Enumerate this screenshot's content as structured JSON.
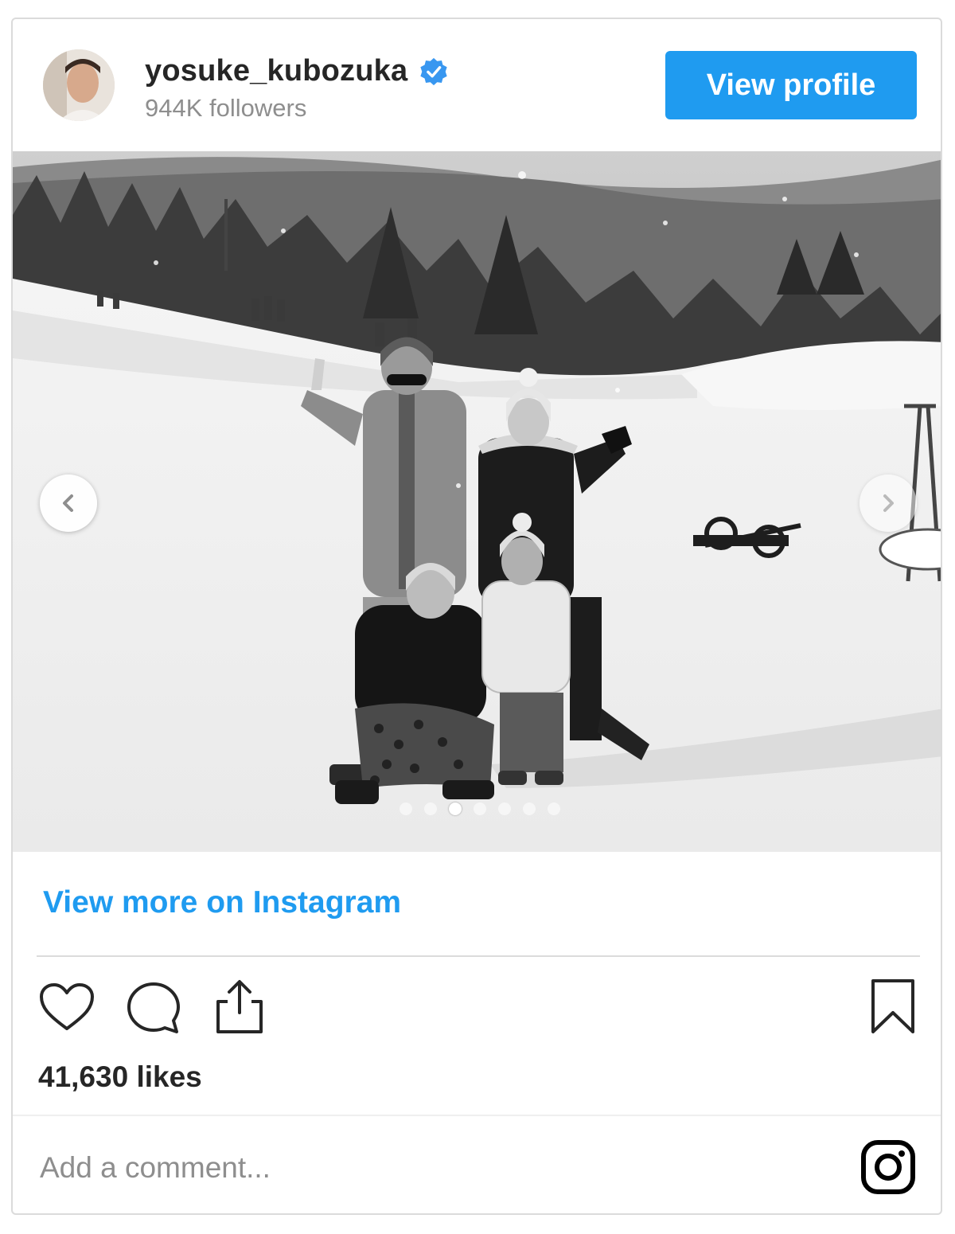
{
  "profile": {
    "username": "yosuke_kubozuka",
    "followers": "944K followers",
    "verified_icon": "verified-badge-icon",
    "view_profile_label": "View profile"
  },
  "post": {
    "image_alt": "Black and white family photo in the snow at a ski area",
    "carousel": {
      "total": 7,
      "active_index": 2
    },
    "view_more_label": "View more on Instagram",
    "likes": "41,630 likes",
    "comment_placeholder": "Add a comment..."
  },
  "icons": {
    "like": "heart-icon",
    "comment": "comment-icon",
    "share": "share-icon",
    "save": "bookmark-icon",
    "brand": "instagram-logo-icon",
    "prev": "chevron-left-icon",
    "next": "chevron-right-icon"
  },
  "colors": {
    "accent": "#1f9bf0",
    "text": "#262626",
    "muted": "#8e8e8e",
    "border": "#dbdbdb"
  }
}
